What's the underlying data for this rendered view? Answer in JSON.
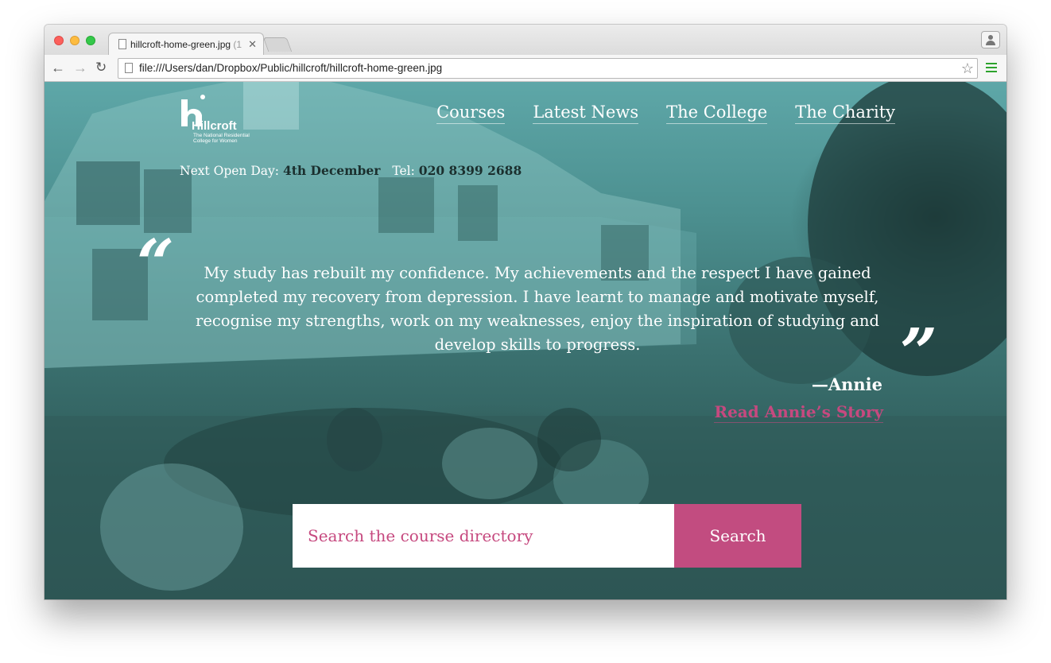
{
  "browser": {
    "tab_title": "hillcroft-home-green.jpg",
    "tab_title_suffix": "(1",
    "address": "file:///Users/dan/Dropbox/Public/hillcroft/hillcroft-home-green.jpg"
  },
  "site": {
    "logo_text": "Hillcroft",
    "logo_tagline_1": "The National Residential",
    "logo_tagline_2": "College for Women",
    "nav": [
      "Courses",
      "Latest News",
      "The College",
      "The Charity"
    ],
    "open_day_label": "Next Open Day:",
    "open_day_value": "4th December",
    "tel_label": "Tel:",
    "tel_value": "020 8399 2688",
    "quote_open_mark": "“",
    "quote_close_mark": "”",
    "quote": "My study has rebuilt my confidence. My achievements and the respect I have gained completed my recovery from depression. I have learnt to manage and motivate myself, recognise my strengths, work on my weaknesses, enjoy the inspiration of studying and develop skills to progress.",
    "author": "—Annie",
    "story_link": "Read Annie’s Story",
    "search_placeholder": "Search the course directory",
    "search_button": "Search"
  },
  "colors": {
    "teal_overlay": "#4c9090",
    "accent_pink": "#c24c80",
    "text_white": "#ffffff"
  },
  "icons": [
    "back-arrow-icon",
    "forward-arrow-icon",
    "reload-icon",
    "page-icon",
    "star-icon",
    "menu-icon",
    "profile-icon",
    "close-icon"
  ]
}
